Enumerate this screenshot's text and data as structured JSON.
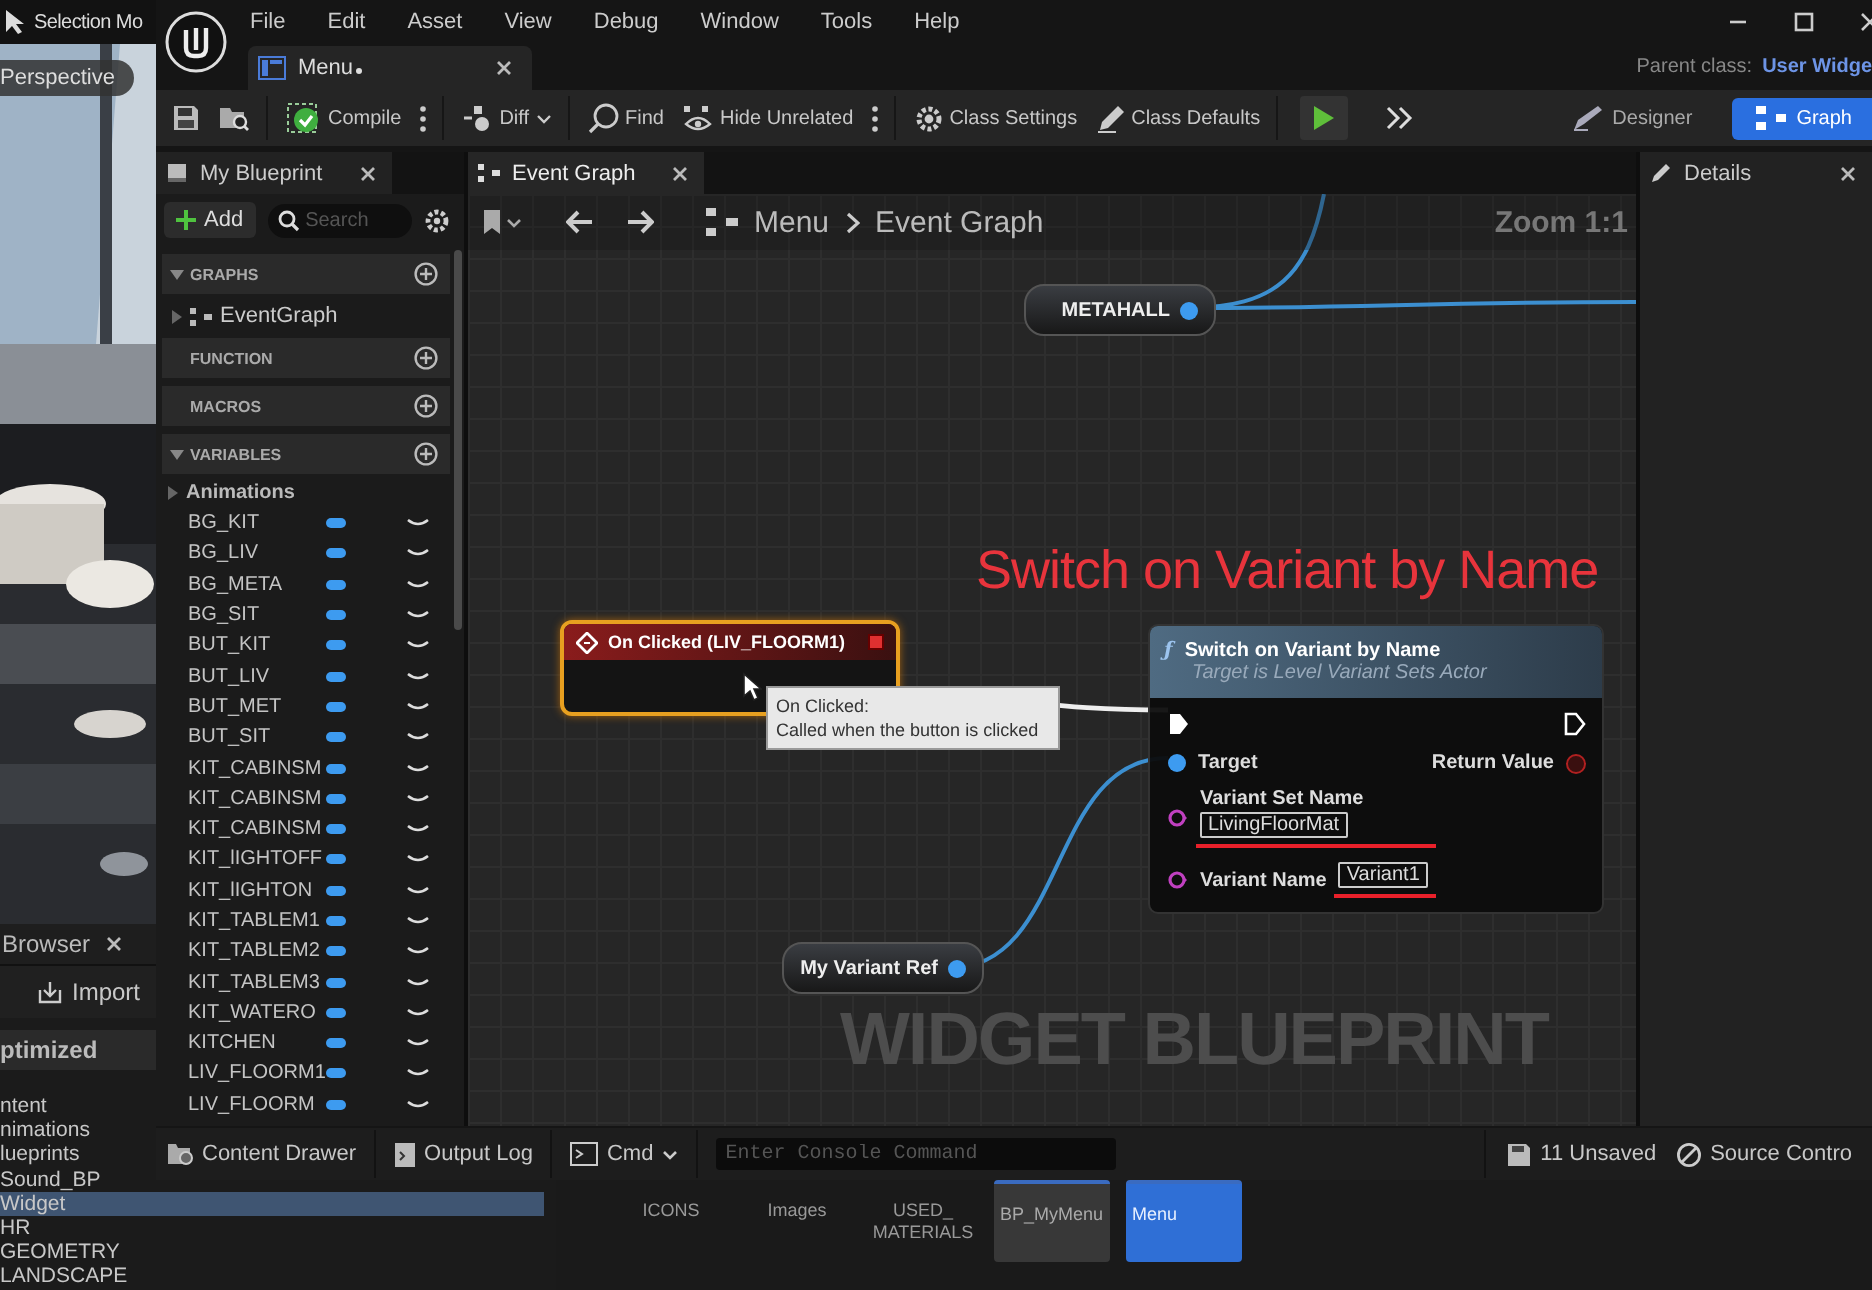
{
  "background_window": {
    "title": "Selection Mo",
    "viewport_label": "Perspective",
    "content_browser": {
      "tab": "Browser",
      "import_button": "Import",
      "header": "ptimized",
      "folders": [
        {
          "label": "ntent",
          "selected": false
        },
        {
          "label": "nimations",
          "selected": false
        },
        {
          "label": "lueprints",
          "selected": false
        },
        {
          "label": "Sound_BP",
          "selected": false
        },
        {
          "label": "Widget",
          "selected": true
        },
        {
          "label": "HR",
          "selected": false
        },
        {
          "label": "GEOMETRY",
          "selected": false
        },
        {
          "label": "LANDSCAPE",
          "selected": false
        }
      ],
      "assets": [
        {
          "label": "ICONS",
          "kind": "folder",
          "selected": false
        },
        {
          "label": "Images",
          "kind": "folder",
          "selected": false
        },
        {
          "label": "USED_ MATERIALS",
          "kind": "folder",
          "selected": false
        },
        {
          "label": "BP_MyMenu",
          "kind": "asset",
          "selected": false
        },
        {
          "label": "Menu",
          "kind": "asset",
          "selected": true
        }
      ]
    }
  },
  "editor": {
    "menu": [
      "File",
      "Edit",
      "Asset",
      "View",
      "Debug",
      "Window",
      "Tools",
      "Help"
    ],
    "document_tab": {
      "label": "Menu",
      "modified": true
    },
    "parent_class": {
      "label": "Parent class:",
      "value": "User Widge"
    },
    "toolbar": [
      {
        "kind": "save"
      },
      {
        "kind": "browse"
      },
      {
        "kind": "compile",
        "label": "Compile"
      },
      {
        "kind": "more"
      },
      {
        "kind": "diff",
        "label": "Diff"
      },
      {
        "kind": "find",
        "label": "Find"
      },
      {
        "kind": "hide",
        "label": "Hide Unrelated"
      },
      {
        "kind": "more"
      },
      {
        "kind": "settings",
        "label": "Class Settings"
      },
      {
        "kind": "defaults",
        "label": "Class Defaults"
      },
      {
        "kind": "play"
      },
      {
        "kind": "overflow"
      }
    ],
    "modes": [
      {
        "label": "Designer",
        "selected": false
      },
      {
        "label": "Graph",
        "selected": true
      }
    ],
    "my_blueprint": {
      "tab": "My Blueprint",
      "add_button": "Add",
      "search": {
        "placeholder": "Search"
      },
      "sections": [
        {
          "label": "GRAPHS",
          "expanded": true,
          "items": [
            {
              "label": "EventGraph",
              "kind": "graph"
            }
          ]
        },
        {
          "label": "FUNCTION",
          "expanded": false
        },
        {
          "label": "MACROS",
          "expanded": false
        },
        {
          "label": "VARIABLES",
          "expanded": true,
          "items": [
            {
              "label": "Animations",
              "kind": "category"
            },
            {
              "label": "BG_KIT",
              "kind": "variable"
            },
            {
              "label": "BG_LIV",
              "kind": "variable"
            },
            {
              "label": "BG_META",
              "kind": "variable"
            },
            {
              "label": "BG_SIT",
              "kind": "variable"
            },
            {
              "label": "BUT_KIT",
              "kind": "variable"
            },
            {
              "label": "BUT_LIV",
              "kind": "variable"
            },
            {
              "label": "BUT_MET",
              "kind": "variable"
            },
            {
              "label": "BUT_SIT",
              "kind": "variable"
            },
            {
              "label": "KIT_CABINSM",
              "kind": "variable"
            },
            {
              "label": "KIT_CABINSM",
              "kind": "variable"
            },
            {
              "label": "KIT_CABINSM",
              "kind": "variable"
            },
            {
              "label": "KIT_lIGHTOFF",
              "kind": "variable"
            },
            {
              "label": "KIT_lIGHTON",
              "kind": "variable"
            },
            {
              "label": "KIT_TABLEM1",
              "kind": "variable"
            },
            {
              "label": "KIT_TABLEM2",
              "kind": "variable"
            },
            {
              "label": "KIT_TABLEM3",
              "kind": "variable"
            },
            {
              "label": "KIT_WATERO",
              "kind": "variable"
            },
            {
              "label": "KITCHEN",
              "kind": "variable"
            },
            {
              "label": "LIV_FLOORM1",
              "kind": "variable"
            },
            {
              "label": "LIV_FLOORM",
              "kind": "variable"
            }
          ]
        }
      ]
    },
    "graph": {
      "tab": "Event Graph",
      "breadcrumb": [
        "Menu",
        "Event Graph"
      ],
      "zoom": "Zoom 1:1",
      "nodes": [
        {
          "kind": "variable",
          "label": "METAHALL",
          "selected": false
        },
        {
          "kind": "event",
          "label": "On Clicked (LIV_FLOORM1)",
          "selected": true
        },
        {
          "kind": "function",
          "icon": "ƒ",
          "label": "Switch on Variant by Name",
          "subtitle": "Target is Level Variant Sets Actor",
          "selected": false,
          "inputs": [
            {
              "label": "Target",
              "kind": "object"
            },
            {
              "label": "Variant Set Name",
              "kind": "name",
              "value": "LivingFloorMat",
              "underlined": true
            },
            {
              "label": "Variant Name",
              "kind": "name",
              "value": "Variant1",
              "underlined": true
            }
          ],
          "outputs": [
            {
              "label": "Return Value",
              "kind": "bool"
            }
          ]
        },
        {
          "kind": "variable",
          "label": "My Variant Ref",
          "selected": false
        }
      ],
      "tooltip": {
        "title": "On Clicked:",
        "text": "Called when the button is clicked"
      },
      "watermark": "WIDGET BLUEPRINT",
      "annotation": "Switch on Variant by Name"
    },
    "details": {
      "tab": "Details"
    },
    "bottom_bar": {
      "buttons": [
        {
          "kind": "drawer",
          "label": "Content Drawer"
        },
        {
          "kind": "log",
          "label": "Output Log"
        },
        {
          "kind": "cmd",
          "label": "Cmd"
        }
      ],
      "console": {
        "placeholder": "Enter Console Command"
      },
      "status": [
        {
          "kind": "unsaved",
          "label": "11 Unsaved"
        },
        {
          "kind": "source",
          "label": "Source Contro"
        }
      ]
    }
  }
}
